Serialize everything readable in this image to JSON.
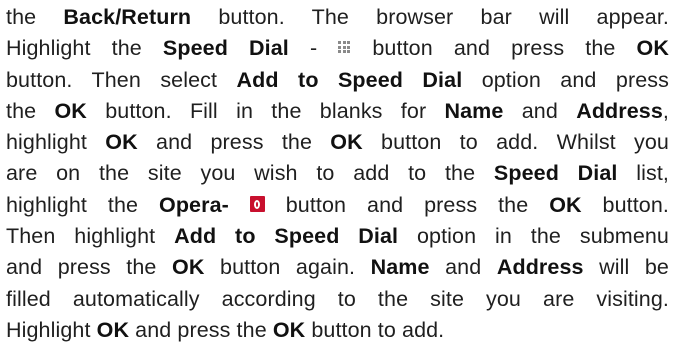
{
  "icons": {
    "speed_dial": "grid-icon",
    "opera": "opera-icon"
  },
  "colors": {
    "text": "#1f1f1f",
    "opera_red": "#c8102e"
  },
  "lines": [
    {
      "t1": "the ",
      "b1": "Back/Return",
      "t2": " button. The browser bar will appear."
    },
    {
      "t1": "Highlight the ",
      "b1": "Speed Dial",
      "t2": " - ",
      "t3": " button and press the ",
      "b2": "OK"
    },
    {
      "t1": "button. Then select ",
      "b1": "Add to Speed Dial",
      "t2": " option and press"
    },
    {
      "t1": "the ",
      "b1": "OK",
      "t2": " button. Fill in the blanks for ",
      "b2": "Name",
      "t3": " and ",
      "b3": "Address",
      "t4": ","
    },
    {
      "t1": "highlight ",
      "b1": "OK",
      "t2": " and press the ",
      "b2": "OK",
      "t3": " button to add. Whilst you"
    },
    {
      "t1": "are on the site you wish to add to the ",
      "b1": "Speed Dial",
      "t2": " list,"
    },
    {
      "t1": "highlight the ",
      "b1": "Opera-",
      "t2": " ",
      "t3": " button and press the ",
      "b2": "OK",
      "t4": " button."
    },
    {
      "t1": "Then highlight ",
      "b1": "Add to Speed Dial",
      "t2": " option in the submenu"
    },
    {
      "t1": "and press the ",
      "b1": "OK",
      "t2": " button again. ",
      "b2": "Name",
      "t3": " and ",
      "b3": "Address",
      "t4": " will be"
    },
    {
      "t1": "filled automatically according to the site you are visiting."
    },
    {
      "t1": "Highlight ",
      "b1": "OK",
      "t2": " and press the ",
      "b2": "OK",
      "t3": " button to add."
    }
  ]
}
